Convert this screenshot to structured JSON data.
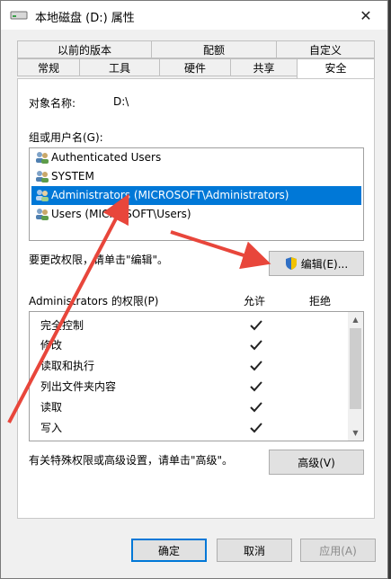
{
  "window": {
    "title": "本地磁盘 (D:) 属性"
  },
  "tabs_row1": [
    "以前的版本",
    "配额",
    "自定义"
  ],
  "tabs_row2": [
    "常规",
    "工具",
    "硬件",
    "共享",
    "安全"
  ],
  "object": {
    "label": "对象名称:",
    "value": "D:\\"
  },
  "groups": {
    "label": "组或用户名(G):",
    "items": [
      "Authenticated Users",
      "SYSTEM",
      "Administrators (MICROSOFT\\Administrators)",
      "Users (MICROSOFT\\Users)"
    ]
  },
  "edit": {
    "hint": "要更改权限，请单击\"编辑\"。",
    "button": "编辑(E)..."
  },
  "permissions": {
    "title": "Administrators 的权限(P)",
    "allow": "允许",
    "deny": "拒绝",
    "rows": [
      "完全控制",
      "修改",
      "读取和执行",
      "列出文件夹内容",
      "读取",
      "写入"
    ]
  },
  "advanced": {
    "hint": "有关特殊权限或高级设置，请单击\"高级\"。",
    "button": "高级(V)"
  },
  "footer": {
    "ok": "确定",
    "cancel": "取消",
    "apply": "应用(A)"
  },
  "colors": {
    "selection": "#0078d7",
    "arrow": "#e8463b"
  }
}
